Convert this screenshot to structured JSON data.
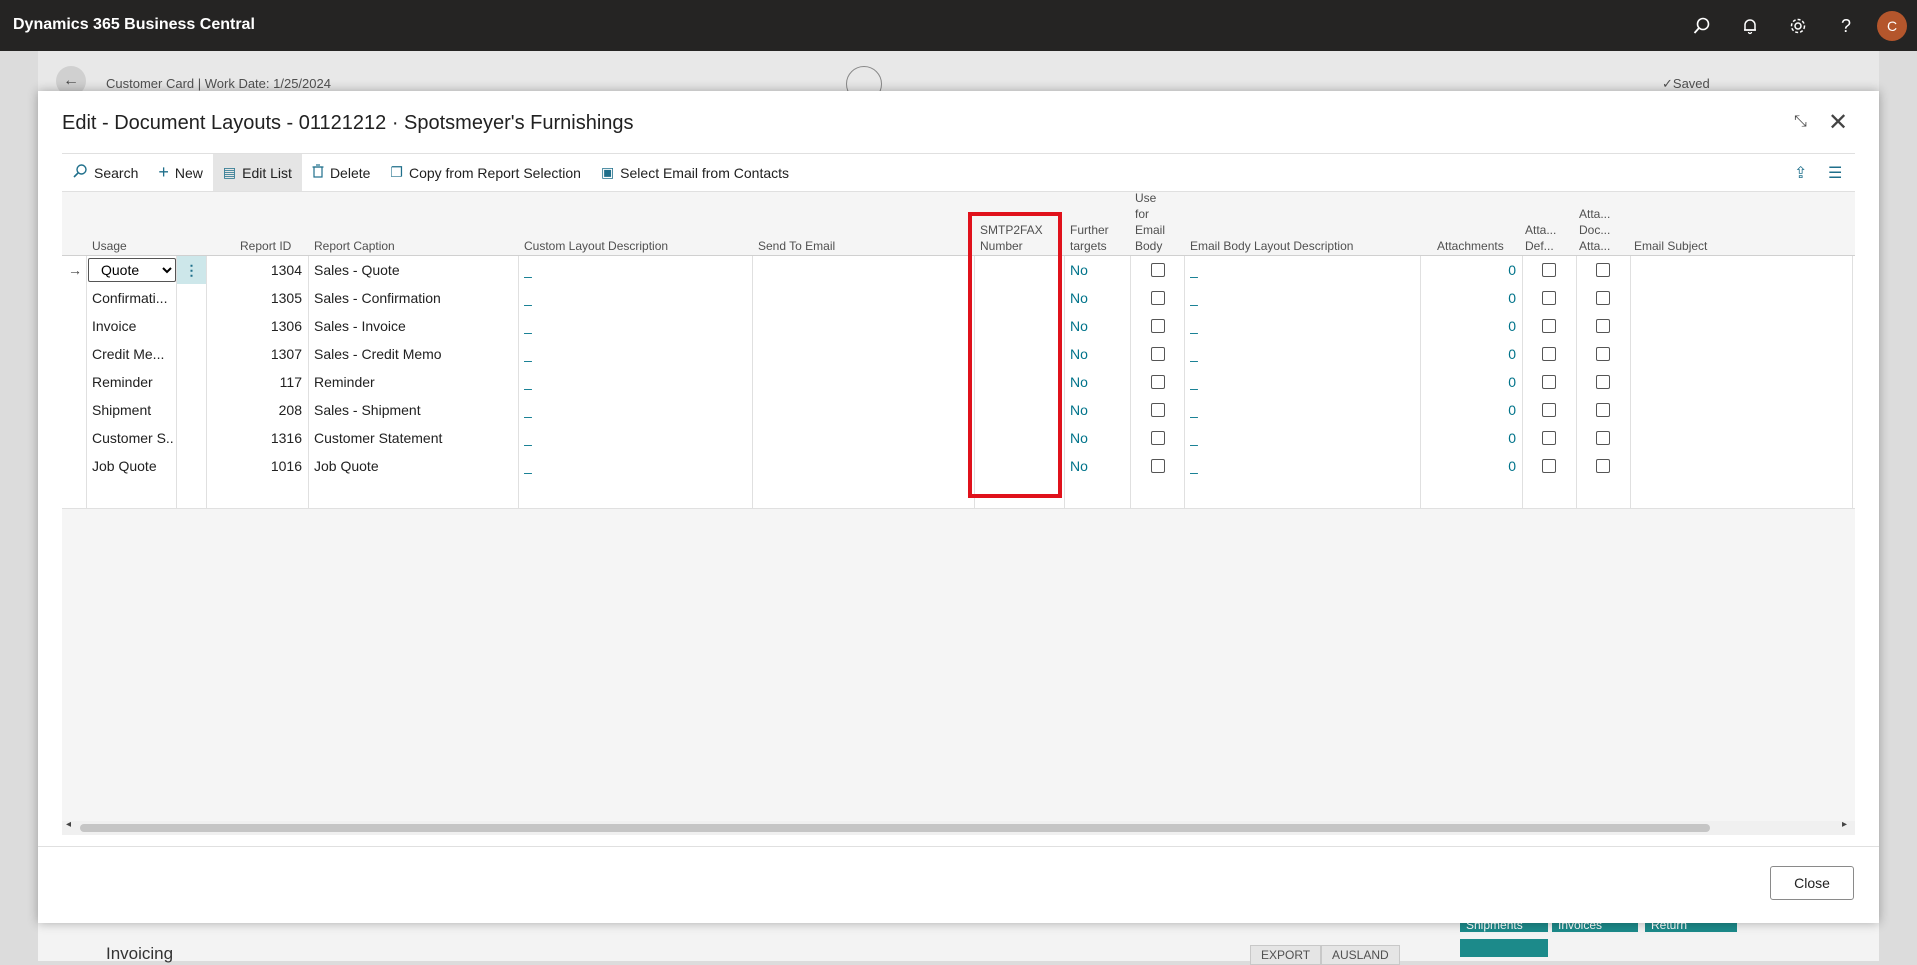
{
  "app": {
    "title": "Dynamics 365 Business Central",
    "avatar_initial": "C"
  },
  "topbar_icons": [
    "search-icon",
    "bell-icon",
    "gear-icon",
    "help-icon"
  ],
  "background": {
    "breadcrumb": "Customer Card | Work Date: 1/25/2024",
    "saved": "Saved",
    "section": "Invoicing",
    "export_btn": "EXPORT",
    "ausland_btn": "AUSLAND",
    "tile1": "Shipments",
    "tile2": "Invoices",
    "tile3": "Return Receipts"
  },
  "modal": {
    "title": "Edit - Document Layouts - 01121212 · Spotsmeyer's Furnishings",
    "close_label": "Close",
    "actions": [
      {
        "label": "Search",
        "icon": "search-icon"
      },
      {
        "label": "New",
        "icon": "plus-icon"
      },
      {
        "label": "Edit List",
        "icon": "edit-list-icon"
      },
      {
        "label": "Delete",
        "icon": "trash-icon"
      },
      {
        "label": "Copy from Report Selection",
        "icon": "copy-icon"
      },
      {
        "label": "Select Email from Contacts",
        "icon": "contact-card-icon"
      }
    ]
  },
  "grid": {
    "headers": {
      "usage": "Usage",
      "report_id": "Report ID",
      "report_caption": "Report Caption",
      "custom_layout": "Custom Layout Description",
      "send_to_email": "Send To Email",
      "smtp2fax_1": "SMTP2FAX",
      "smtp2fax_2": "Number",
      "further_1": "Further",
      "further_2": "targets",
      "use_email_1": "Use",
      "use_email_2": "for",
      "use_email_3": "Email",
      "use_email_4": "Body",
      "email_body_layout": "Email Body Layout Description",
      "attachments": "Attachments",
      "atta_def_1": "Atta...",
      "atta_def_2": "Def...",
      "atta_doc_1": "Atta...",
      "atta_doc_2": "Doc...",
      "atta_doc_3": "Atta...",
      "email_subject": "Email Subject"
    },
    "rows": [
      {
        "usage": "Quote",
        "report_id": "1304",
        "caption": "Sales - Quote",
        "custom_layout": "_",
        "further": "No",
        "email_body": "_",
        "attachments": "0"
      },
      {
        "usage": "Confirmati...",
        "report_id": "1305",
        "caption": "Sales - Confirmation",
        "custom_layout": "_",
        "further": "No",
        "email_body": "_",
        "attachments": "0"
      },
      {
        "usage": "Invoice",
        "report_id": "1306",
        "caption": "Sales - Invoice",
        "custom_layout": "_",
        "further": "No",
        "email_body": "_",
        "attachments": "0"
      },
      {
        "usage": "Credit Me...",
        "report_id": "1307",
        "caption": "Sales - Credit Memo",
        "custom_layout": "_",
        "further": "No",
        "email_body": "_",
        "attachments": "0"
      },
      {
        "usage": "Reminder",
        "report_id": "117",
        "caption": "Reminder",
        "custom_layout": "_",
        "further": "No",
        "email_body": "_",
        "attachments": "0"
      },
      {
        "usage": "Shipment",
        "report_id": "208",
        "caption": "Sales - Shipment",
        "custom_layout": "_",
        "further": "No",
        "email_body": "_",
        "attachments": "0"
      },
      {
        "usage": "Customer S...",
        "report_id": "1316",
        "caption": "Customer Statement",
        "custom_layout": "_",
        "further": "No",
        "email_body": "_",
        "attachments": "0"
      },
      {
        "usage": "Job Quote",
        "report_id": "1016",
        "caption": "Job Quote",
        "custom_layout": "_",
        "further": "No",
        "email_body": "_",
        "attachments": "0"
      }
    ]
  },
  "colors": {
    "link": "#00738a",
    "highlight": "#e0111b",
    "topbar": "#252423"
  }
}
